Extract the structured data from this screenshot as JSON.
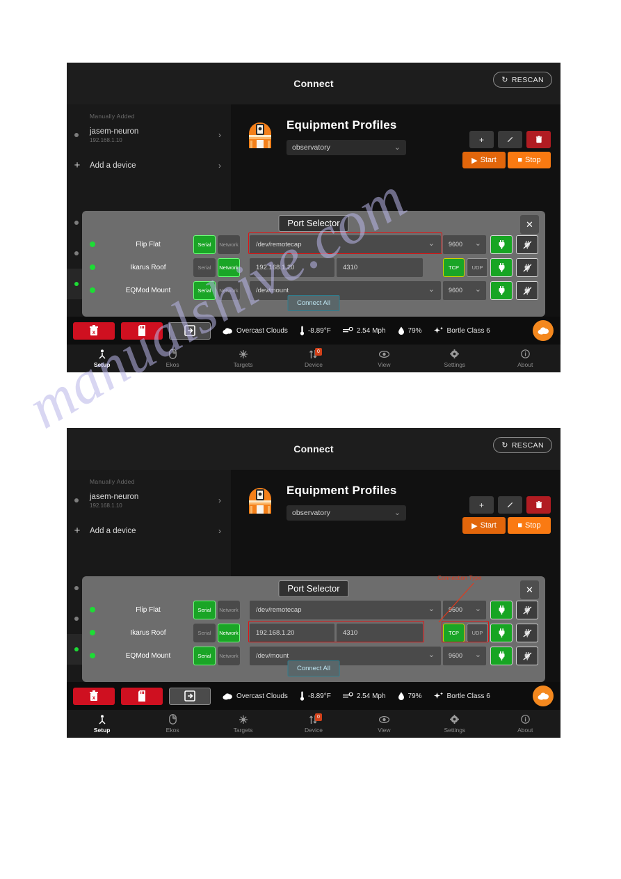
{
  "app": {
    "titlebar": {
      "title": "Connect",
      "rescan_label": "RESCAN",
      "rescan_icon": "refresh-icon"
    },
    "sidebar": {
      "header": "Manually Added",
      "items": [
        {
          "name": "jasem-neuron",
          "sub": "192.168.1.10",
          "icon": "status-dot",
          "chevron": "›"
        },
        {
          "name": "Add a device",
          "sub": "",
          "icon": "plus-icon",
          "chevron": "›"
        }
      ]
    },
    "profiles": {
      "icon": "observatory-dome-icon",
      "title": "Equipment Profiles",
      "selected_profile": "observatory",
      "caret": "⌄",
      "buttons": [
        {
          "name": "add-profile-button",
          "label": "+"
        },
        {
          "name": "edit-profile-button",
          "label": "╱"
        },
        {
          "name": "delete-profile-button",
          "label": "Ὕ1"
        }
      ],
      "start_label": "Start",
      "stop_label": "Stop",
      "start_icon": "play-icon",
      "stop_icon": "stop-icon"
    },
    "dialog": {
      "title": "Port Selector",
      "close_label": "✕",
      "connect_all_label": "Connect All",
      "serial_label": "Serial",
      "network_label": "Network",
      "tcp_label": "TCP",
      "udp_label": "UDP",
      "connect_icon": "plug-icon",
      "disconnect_icon": "plug-off-icon",
      "rows": [
        {
          "device": "Flip Flat",
          "mode": "serial",
          "port": "/dev/remotecap",
          "baud": "9600",
          "caret": "⌄"
        },
        {
          "device": "Ikarus Roof",
          "mode": "network",
          "host": "192.168.1.20",
          "port_number": "4310",
          "protocol": "TCP",
          "caret": "⌄"
        },
        {
          "device": "EQMod Mount",
          "mode": "serial",
          "port": "/dev/mount",
          "baud": "9600",
          "caret": "⌄"
        }
      ]
    },
    "statusbar": {
      "buttons": [
        {
          "name": "clear-button",
          "icon": "trash-x-icon"
        },
        {
          "name": "sd-card-button",
          "icon": "sd-card-icon"
        },
        {
          "name": "login-button",
          "icon": "sign-in-icon"
        }
      ],
      "weather": [
        {
          "icon": "cloud-icon",
          "value": "Overcast Clouds"
        },
        {
          "icon": "thermometer-icon",
          "value": "-8.89°F"
        },
        {
          "icon": "wind-icon",
          "value": "2.54 Mph"
        },
        {
          "icon": "humidity-drop-icon",
          "value": "79%"
        },
        {
          "icon": "sparkle-icon",
          "value": "Bortle Class 6"
        }
      ],
      "fab_icon": "cloud-fab-icon"
    },
    "navbar": {
      "items": [
        {
          "label": "Setup",
          "icon": "setup-icon",
          "active": true,
          "badge": ""
        },
        {
          "label": "Ekos",
          "icon": "mouse-icon",
          "active": false,
          "badge": ""
        },
        {
          "label": "Targets",
          "icon": "star-icon",
          "active": false,
          "badge": ""
        },
        {
          "label": "Device",
          "icon": "transfer-icon",
          "active": false,
          "badge": "0"
        },
        {
          "label": "View",
          "icon": "eye-icon",
          "active": false,
          "badge": ""
        },
        {
          "label": "Settings",
          "icon": "gear-icon",
          "active": false,
          "badge": ""
        },
        {
          "label": "About",
          "icon": "info-icon",
          "active": false,
          "badge": ""
        }
      ]
    }
  },
  "annotations": {
    "second_screen_label": "Connection Type"
  },
  "watermark": {
    "text": "manualshive.com"
  },
  "colors": {
    "accent_orange": "#f4881e",
    "start_orange": "#e2660b",
    "stop_orange": "#fa7a12",
    "danger_red": "#b11c22",
    "status_green": "#1ddc35",
    "connect_green": "#17a523",
    "highlight_red": "#e01414",
    "dialog_grey": "#6d6d6d"
  }
}
